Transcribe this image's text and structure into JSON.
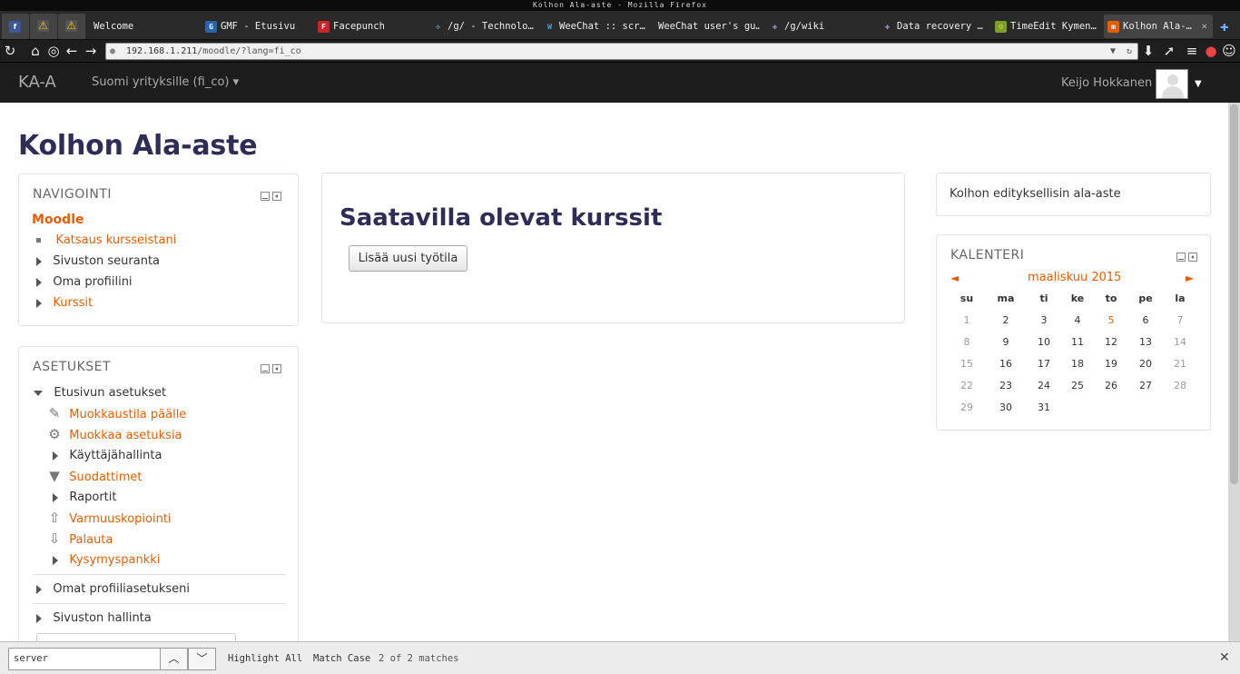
{
  "window": {
    "title": "Kolhon Ala-aste - Mozilla Firefox"
  },
  "tabs": [
    {
      "label": "",
      "icon": "facebook-icon"
    },
    {
      "label": "",
      "icon": "warning-icon"
    },
    {
      "label": "",
      "icon": "warning-icon"
    },
    {
      "label": "Welcome",
      "icon": ""
    },
    {
      "label": "GMF - Etusivu",
      "icon": "gmf-icon"
    },
    {
      "label": "Facepunch",
      "icon": "facepunch-icon"
    },
    {
      "label": "/g/ - Technolo…",
      "icon": "4chan-icon"
    },
    {
      "label": "WeeChat :: scr…",
      "icon": "weechat-icon"
    },
    {
      "label": "WeeChat user's gu…",
      "icon": ""
    },
    {
      "label": "/g/wiki",
      "icon": "wiki-icon"
    },
    {
      "label": "Data recovery …",
      "icon": "wiki-icon"
    },
    {
      "label": "TimeEdit Kymen…",
      "icon": "timeedit-icon"
    },
    {
      "label": "Kolhon Ala-…",
      "icon": "moodle-icon"
    }
  ],
  "urlbar": {
    "host": "192.168.1.211",
    "path": "/moodle/?lang=fi_co"
  },
  "moodle": {
    "brand": "KA-A",
    "language": "Suomi yrityksille (fi_co)",
    "user": "Keijo Hokkanen"
  },
  "site": {
    "title": "Kolhon Ala-aste"
  },
  "navigation": {
    "heading": "NAVIGOINTI",
    "root": "Moodle",
    "items": [
      {
        "label": "Katsaus kursseistani"
      },
      {
        "label": "Sivuston seuranta"
      },
      {
        "label": "Oma profiilini"
      },
      {
        "label": "Kurssit"
      }
    ]
  },
  "settings": {
    "heading": "ASETUKSET",
    "section": "Etusivun asetukset",
    "items": [
      {
        "label": "Muokkaustila päälle",
        "icon": "pencil-icon"
      },
      {
        "label": "Muokkaa asetuksia",
        "icon": "gear-icon"
      },
      {
        "label": "Käyttäjähallinta",
        "icon": "expand-icon"
      },
      {
        "label": "Suodattimet",
        "icon": "filter-icon"
      },
      {
        "label": "Raportit",
        "icon": "expand-icon"
      },
      {
        "label": "Varmuuskopiointi",
        "icon": "backup-icon"
      },
      {
        "label": "Palauta",
        "icon": "restore-icon"
      },
      {
        "label": "Kysymyspankki",
        "icon": "expand-icon"
      }
    ],
    "profile": "Omat profiiliasetukseni",
    "admin": "Sivuston hallinta"
  },
  "main": {
    "heading": "Saatavilla olevat kurssit",
    "add_button": "Lisää uusi työtila"
  },
  "summary": {
    "text": "Kolhon edityksellisin ala-aste"
  },
  "calendar": {
    "heading": "KALENTERI",
    "month": "maaliskuu 2015",
    "prev": "◄",
    "next": "►",
    "weekdays": [
      "su",
      "ma",
      "ti",
      "ke",
      "to",
      "pe",
      "la"
    ],
    "weeks": [
      [
        "1",
        "2",
        "3",
        "4",
        "5",
        "6",
        "7"
      ],
      [
        "8",
        "9",
        "10",
        "11",
        "12",
        "13",
        "14"
      ],
      [
        "15",
        "16",
        "17",
        "18",
        "19",
        "20",
        "21"
      ],
      [
        "22",
        "23",
        "24",
        "25",
        "26",
        "27",
        "28"
      ],
      [
        "29",
        "30",
        "31",
        "",
        "",
        "",
        ""
      ]
    ],
    "today": "5"
  },
  "findbar": {
    "query": "server",
    "highlight": "Highlight All",
    "match_case": "Match Case",
    "matches": "2 of 2 matches"
  }
}
